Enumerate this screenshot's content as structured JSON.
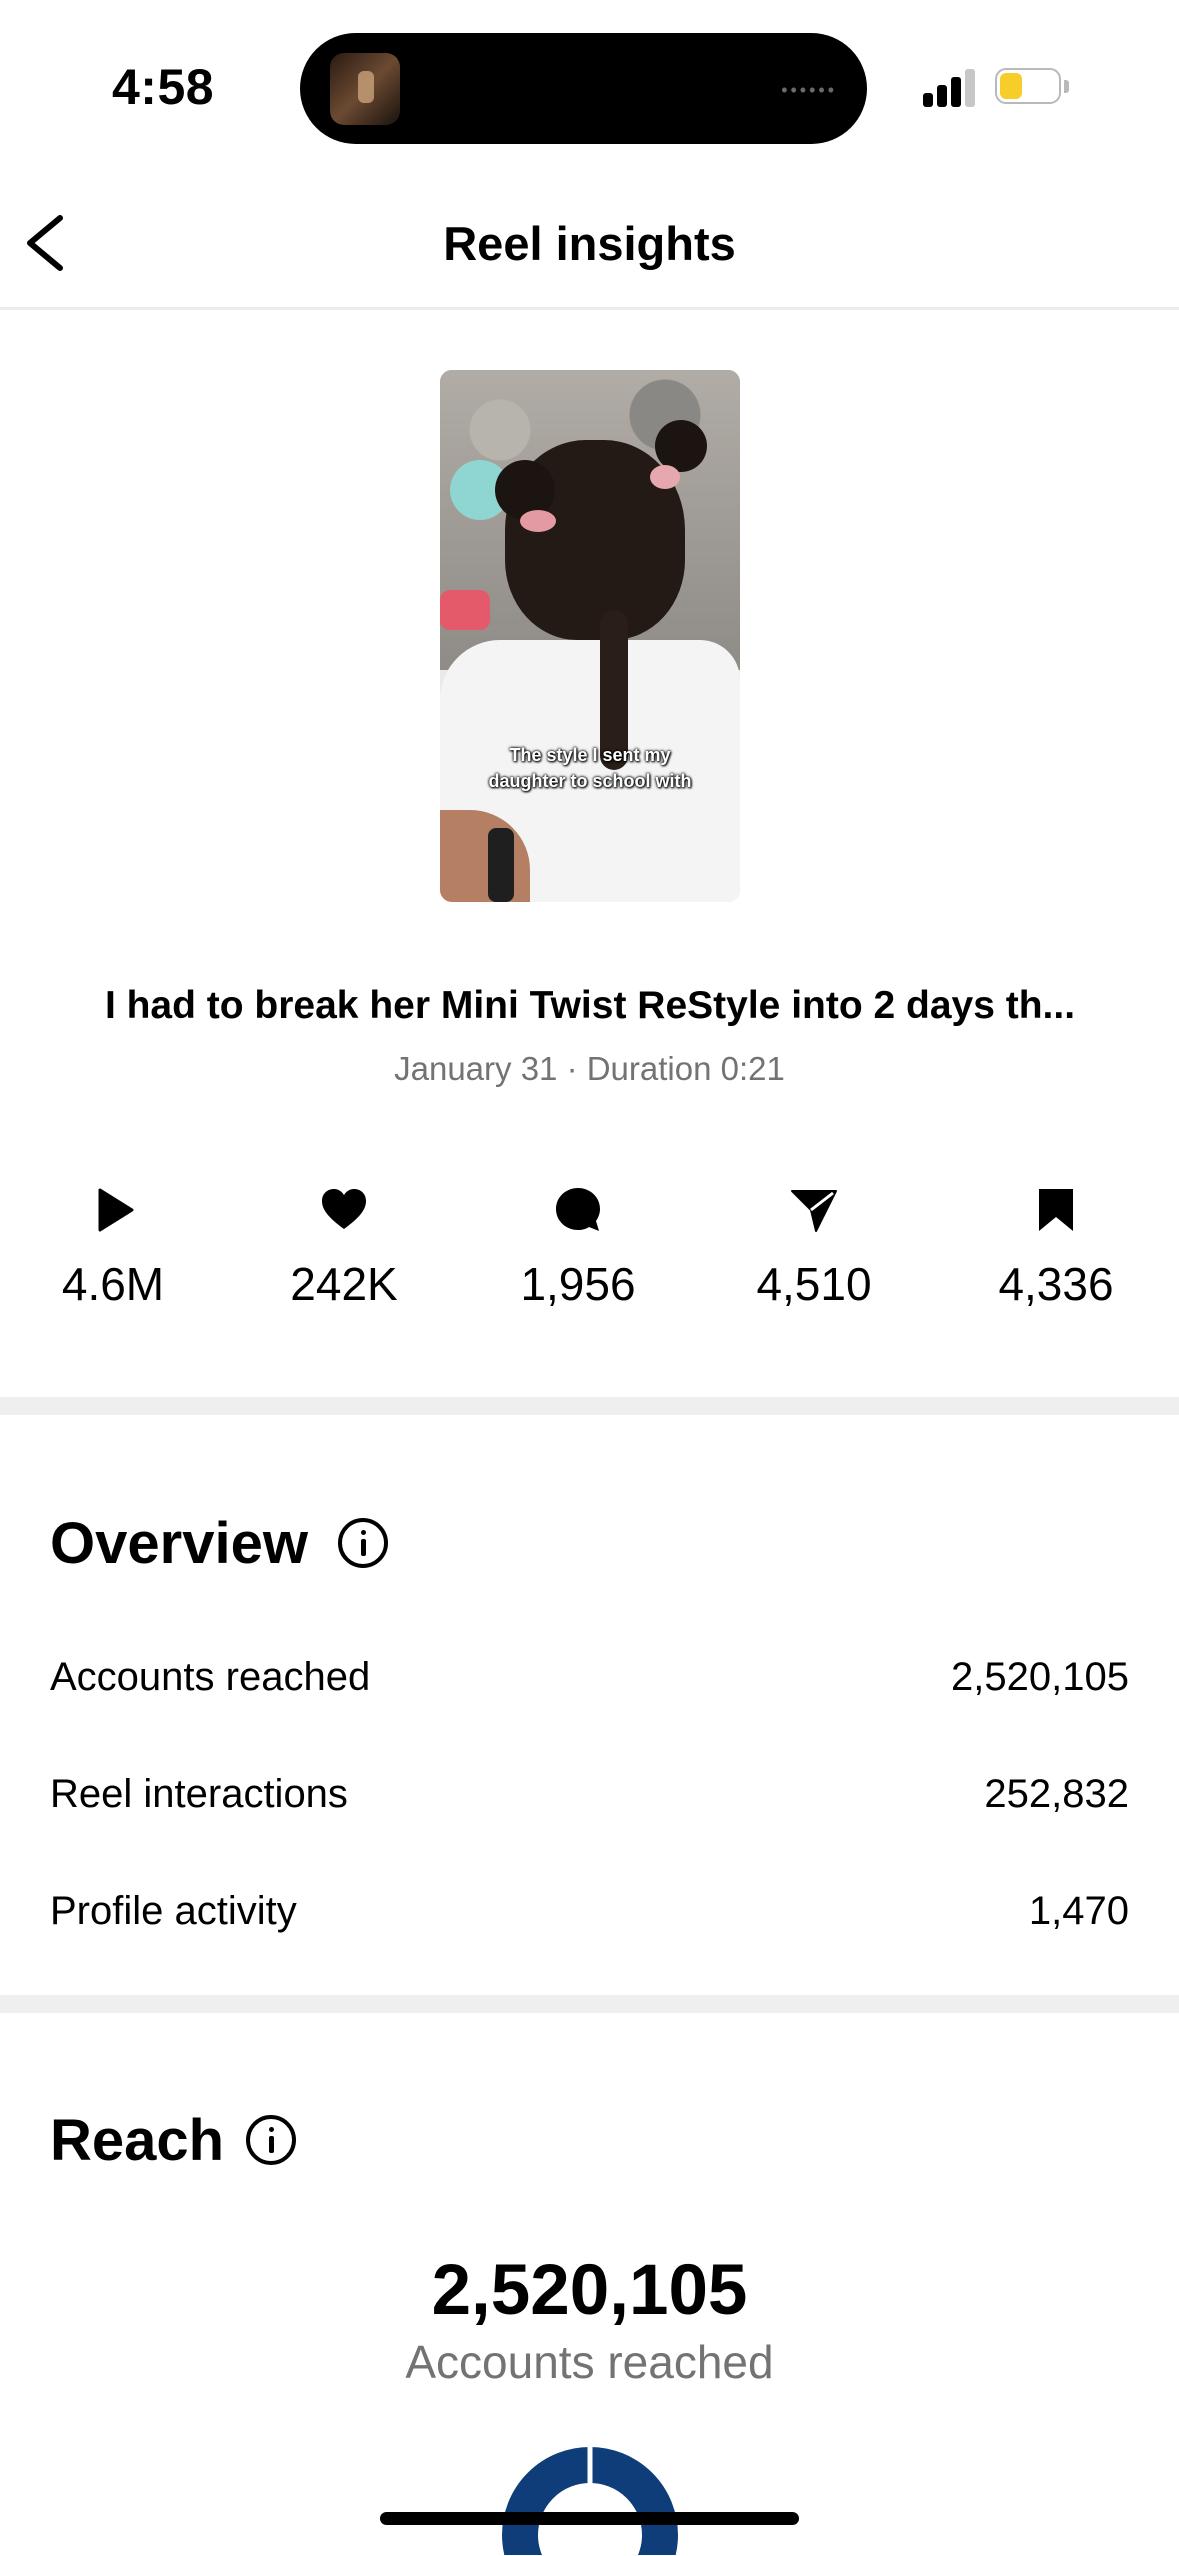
{
  "status_bar": {
    "time": "4:58",
    "battery_color": "#f7cd2a"
  },
  "header": {
    "back_icon": "chevron-left-icon",
    "title": "Reel insights"
  },
  "reel": {
    "overlay_caption_line1": "The style I sent my",
    "overlay_caption_line2": "daughter to school with",
    "caption": "I had to break her Mini Twist ReStyle into 2 days th...",
    "meta": "January 31 · Duration 0:21"
  },
  "stats": [
    {
      "icon": "play-icon",
      "value": "4.6M"
    },
    {
      "icon": "heart-icon",
      "value": "242K"
    },
    {
      "icon": "comment-icon",
      "value": "1,956"
    },
    {
      "icon": "send-icon",
      "value": "4,510"
    },
    {
      "icon": "bookmark-icon",
      "value": "4,336"
    }
  ],
  "overview": {
    "heading": "Overview",
    "rows": [
      {
        "label": "Accounts reached",
        "value": "2,520,105"
      },
      {
        "label": "Reel interactions",
        "value": "252,832"
      },
      {
        "label": "Profile activity",
        "value": "1,470"
      }
    ]
  },
  "reach": {
    "heading": "Reach",
    "value": "2,520,105",
    "label": "Accounts reached",
    "gauge_color": "#0f3d7a"
  }
}
